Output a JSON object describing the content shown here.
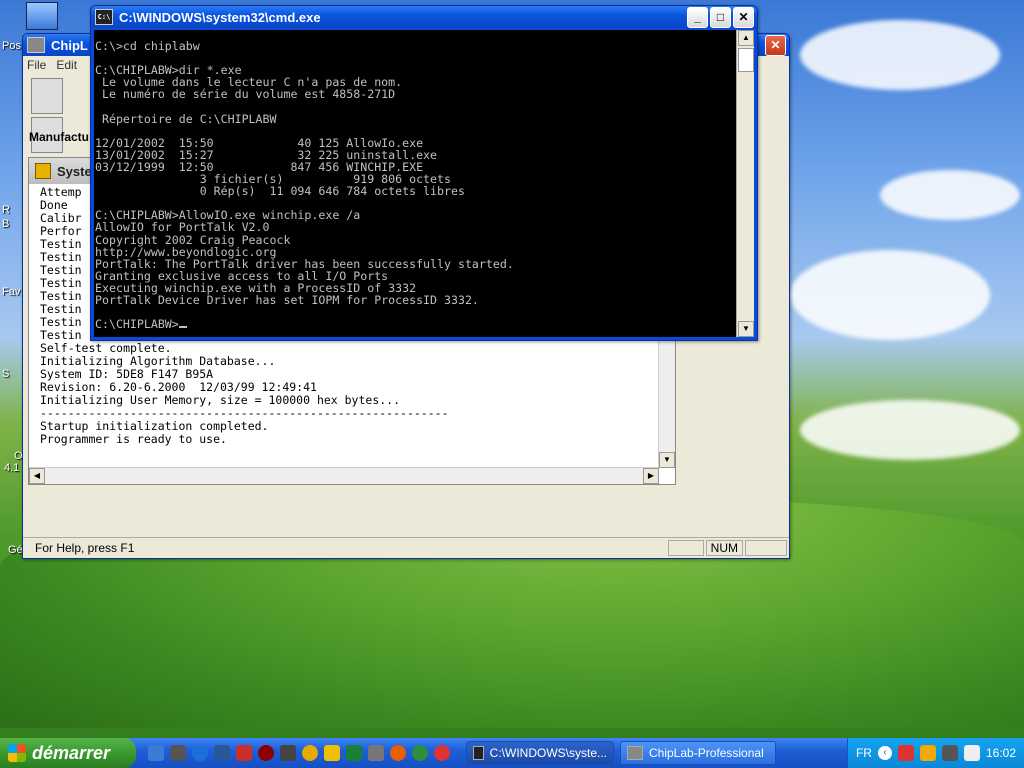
{
  "desktop": {
    "labels": [
      "Pos",
      "R",
      "B",
      "Fav",
      "S",
      "O",
      "4.1",
      "Gé"
    ]
  },
  "chiplab": {
    "title": "ChipL",
    "menu": [
      "File",
      "Edit"
    ],
    "manufacturer_label": "Manufactu",
    "status_help": "For Help, press F1",
    "status_num": "NUM",
    "system_window": {
      "title": "Syste",
      "log": "Attemp\nDone\nCalibr\nPerfor\nTestin\nTestin\nTestin\nTestin\nTestin\nTestin\nTestin\nTestin\nSelf-test complete.\nInitializing Algorithm Database...\nSystem ID: 5DE8 F147 B95A\nRevision: 6.20-6.2000  12/03/99 12:49:41\nInitializing User Memory, size = 100000 hex bytes...\n-----------------------------------------------------------\nStartup initialization completed.\nProgrammer is ready to use."
    }
  },
  "cmd": {
    "title": "C:\\WINDOWS\\system32\\cmd.exe",
    "output": "C:\\>cd chiplabw\n\nC:\\CHIPLABW>dir *.exe\n Le volume dans le lecteur C n'a pas de nom.\n Le numéro de série du volume est 4858-271D\n\n Répertoire de C:\\CHIPLABW\n\n12/01/2002  15:50            40 125 AllowIo.exe\n13/01/2002  15:27            32 225 uninstall.exe\n03/12/1999  12:50           847 456 WINCHIP.EXE\n               3 fichier(s)          919 806 octets\n               0 Rép(s)  11 094 646 784 octets libres\n\nC:\\CHIPLABW>AllowIO.exe winchip.exe /a\nAllowIO for PortTalk V2.0\nCopyright 2002 Craig Peacock\nhttp://www.beyondlogic.org\nPortTalk: The PortTalk driver has been successfully started.\nGranting exclusive access to all I/O Ports\nExecuting winchip.exe with a ProcessID of 3332\nPortTalk Device Driver has set IOPM for ProcessID 3332.\n\nC:\\CHIPLABW>"
  },
  "taskbar": {
    "start_label": "démarrer",
    "tasks": [
      "C:\\WINDOWS\\syste...",
      "ChipLab-Professional"
    ],
    "language": "FR",
    "clock": "16:02"
  },
  "colors": {
    "title_blue": "#0a55e0",
    "start_green": "#3a9a2e",
    "tray_blue": "#0b88d8"
  }
}
